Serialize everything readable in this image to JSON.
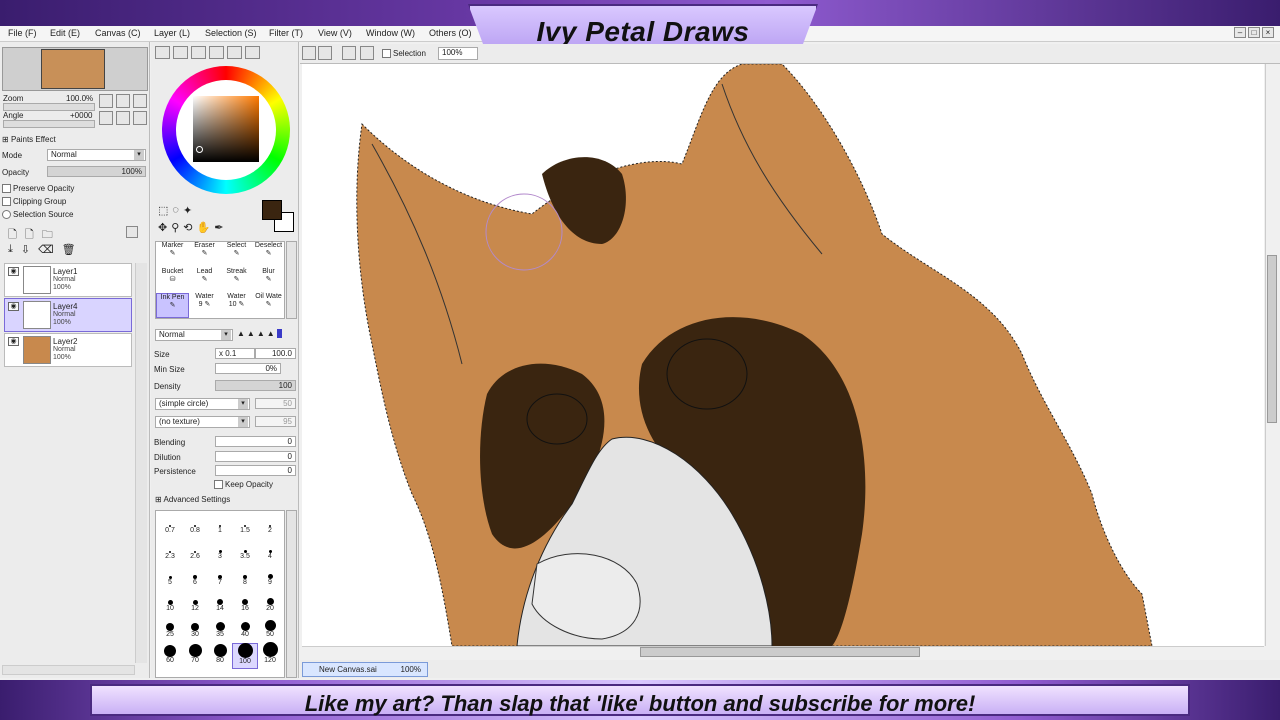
{
  "banner_title": "Ivy Petal Draws",
  "footer_text": "Like my art? Than slap that 'like' button and subscribe for more!",
  "menu": [
    "File (F)",
    "Edit (E)",
    "Canvas (C)",
    "Layer (L)",
    "Selection (S)",
    "Filter (T)",
    "View (V)",
    "Window (W)",
    "Others (O)"
  ],
  "navigator": {
    "zoom_label": "Zoom",
    "zoom_value": "100.0%",
    "angle_label": "Angle",
    "angle_value": "+0000"
  },
  "paint_effects": {
    "header": "Paints Effect",
    "mode_label": "Mode",
    "mode_value": "Normal",
    "opacity_label": "Opacity",
    "opacity_value": "100%",
    "preserve_opacity": "Preserve Opacity",
    "clipping_group": "Clipping Group",
    "selection_source": "Selection Source"
  },
  "layers": [
    {
      "name": "Layer1",
      "mode": "Normal",
      "opacity": "100%",
      "selected": false
    },
    {
      "name": "Layer4",
      "mode": "Normal",
      "opacity": "100%",
      "selected": true
    },
    {
      "name": "Layer2",
      "mode": "Normal",
      "opacity": "100%",
      "selected": false
    }
  ],
  "tools": [
    {
      "label": "Marker"
    },
    {
      "label": "Eraser"
    },
    {
      "label": "Select"
    },
    {
      "label": "Deselect"
    },
    {
      "label": "Bucket"
    },
    {
      "label": "Lead"
    },
    {
      "label": "Streak"
    },
    {
      "label": "Blur"
    },
    {
      "label": "Ink Pen"
    },
    {
      "label": "Water"
    },
    {
      "label": "Water"
    },
    {
      "label": "Oil Wate"
    }
  ],
  "tool_sublabels": [
    "9",
    "10"
  ],
  "brush": {
    "blend_mode": "Normal",
    "size_label": "Size",
    "size_mult": "x 0.1",
    "size_value": "100.0",
    "min_size_label": "Min Size",
    "min_size_value": "0%",
    "density_label": "Density",
    "density_value": "100",
    "shape": "(simple circle)",
    "shape_value": "50",
    "texture": "(no texture)",
    "texture_value": "95",
    "blending_label": "Blending",
    "blending_value": "0",
    "dilution_label": "Dilution",
    "dilution_value": "0",
    "persistence_label": "Persistence",
    "persistence_value": "0",
    "keep_opacity": "Keep Opacity",
    "advanced": "Advanced Settings"
  },
  "brush_sizes": [
    "0.7",
    "0.8",
    "1",
    "1.5",
    "2",
    "2.3",
    "2.6",
    "3",
    "3.5",
    "4",
    "5",
    "6",
    "7",
    "8",
    "9",
    "10",
    "12",
    "14",
    "16",
    "20",
    "25",
    "30",
    "35",
    "40",
    "50",
    "60",
    "70",
    "80",
    "100",
    "120"
  ],
  "canvas_toolbar": {
    "selection_label": "Selection",
    "zoom_value": "100%"
  },
  "document_tab": {
    "name": "New Canvas.sai",
    "zoom": "100%"
  },
  "colors": {
    "fur": "#c8894d",
    "dark_patch": "#3a2510",
    "muzzle": "#e4e4e4",
    "accent": "#7a6ad8"
  }
}
